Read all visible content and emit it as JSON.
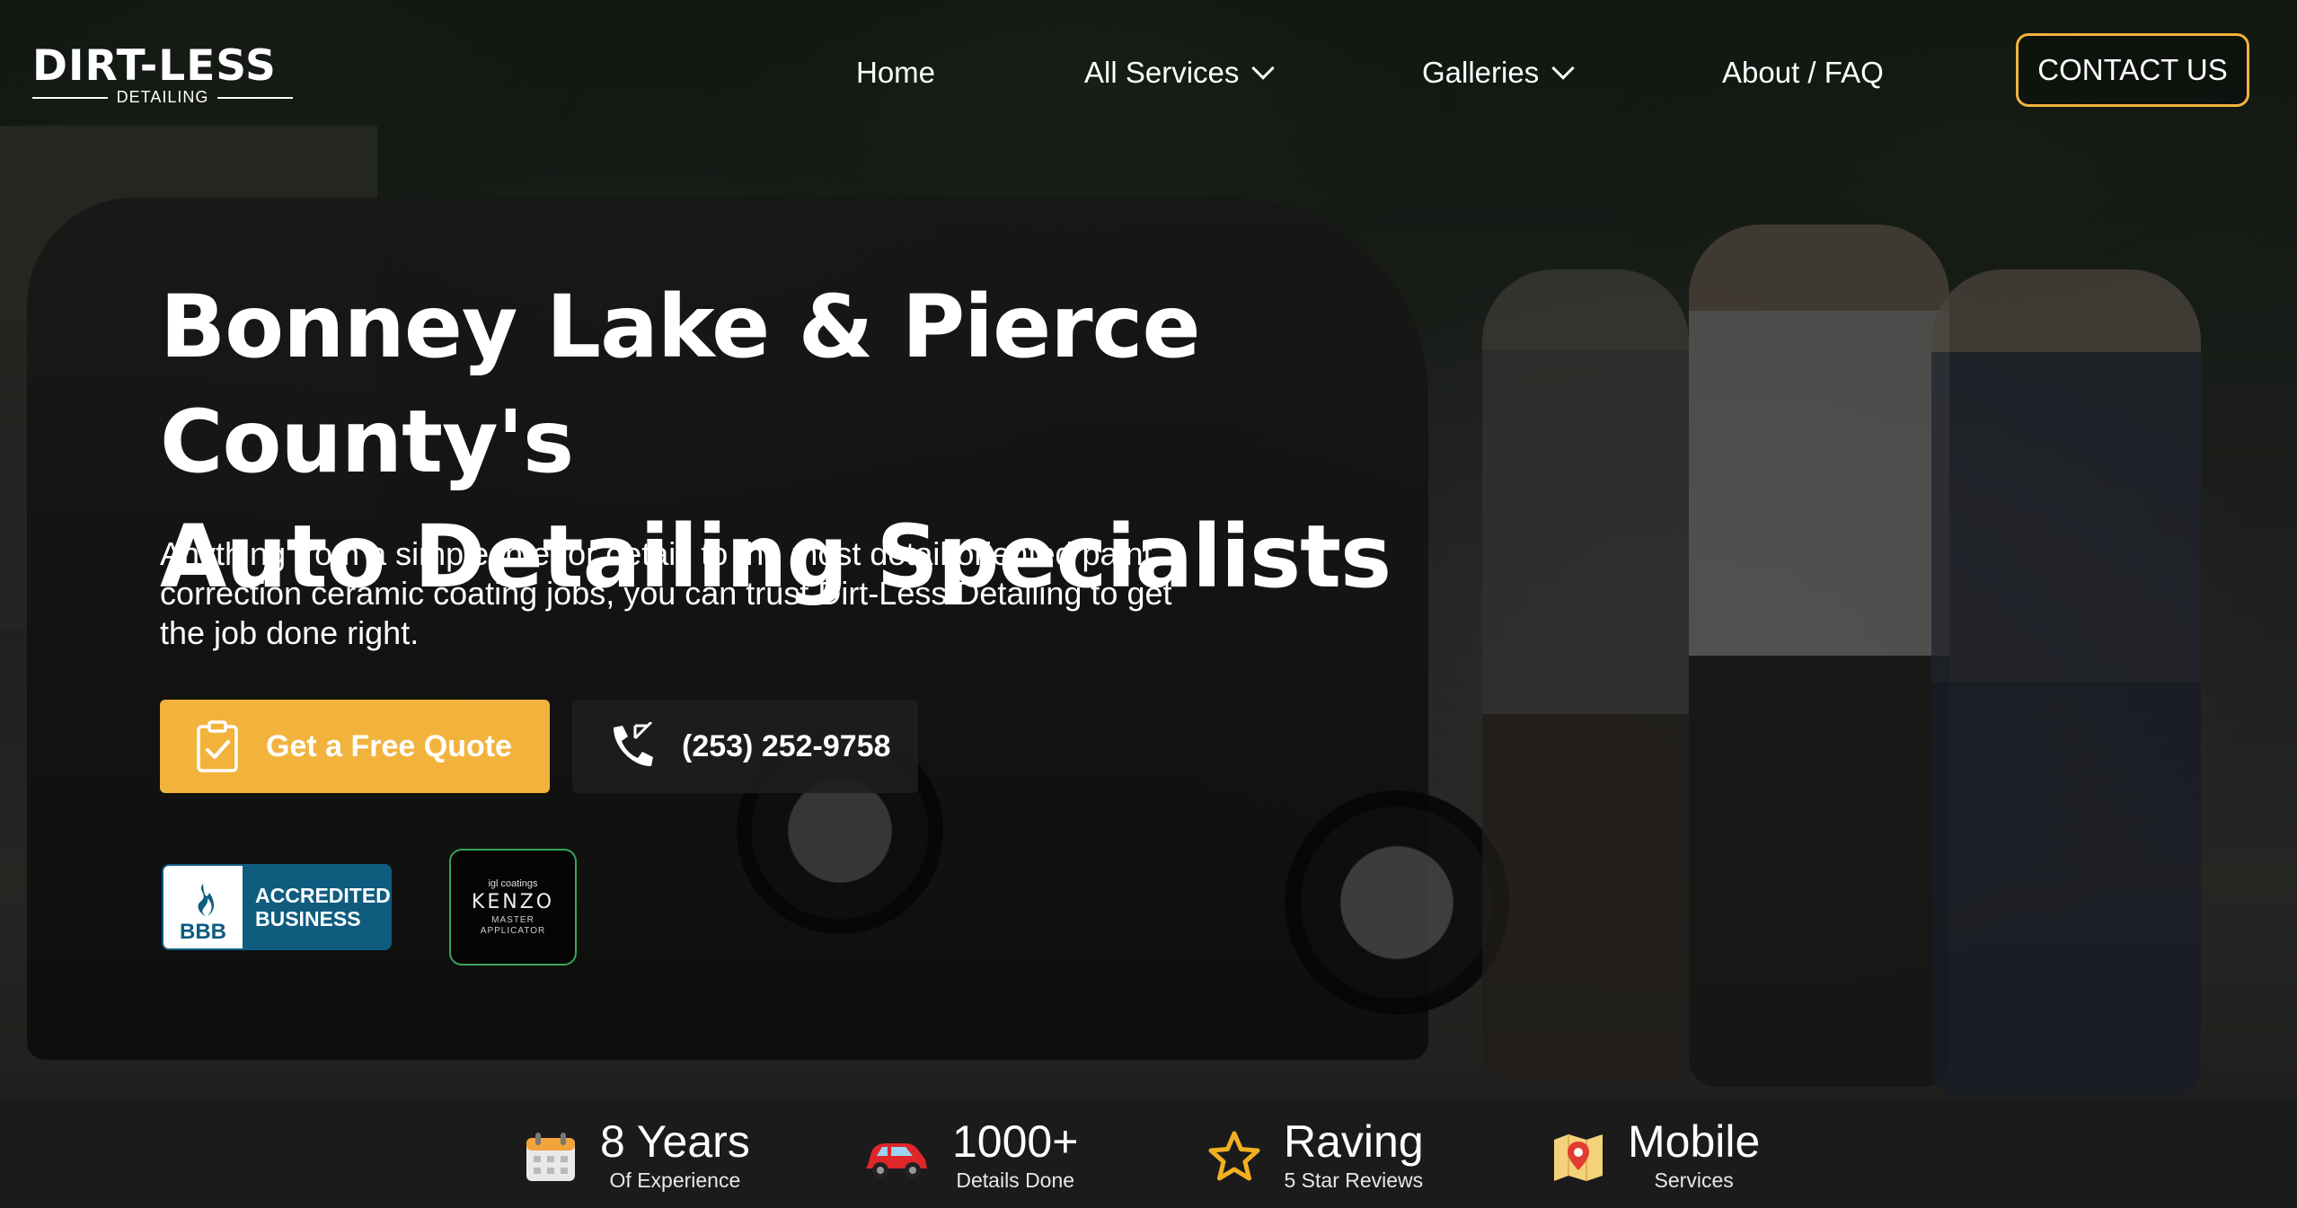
{
  "brand": {
    "logo_main": "DIRT-LESS",
    "logo_sub": "DETAILING"
  },
  "nav": {
    "home": "Home",
    "services": "All Services",
    "galleries": "Galleries",
    "about": "About / FAQ",
    "contact": "CONTACT US"
  },
  "hero": {
    "headline_line1": "Bonney Lake & Pierce County's",
    "headline_line2": "Auto Detailing Specialists",
    "subtext": "Anything from a simple interior detail, to the most detail oriented paint correction ceramic coating jobs, you can trust Dirt-Less Detailing to get the job done right.",
    "quote_button": "Get a Free Quote",
    "phone_button": "(253) 252-9758"
  },
  "badges": {
    "bbb_mark": "BBB",
    "bbb_line1": "ACCREDITED",
    "bbb_line2": "BUSINESS",
    "kenzo_top": "igl coatings",
    "kenzo_name": "KENZO",
    "kenzo_line1": "MASTER",
    "kenzo_line2": "APPLICATOR"
  },
  "stats": [
    {
      "big": "8 Years",
      "small": "Of Experience",
      "icon": "calendar-icon"
    },
    {
      "big": "1000+",
      "small": "Details Done",
      "icon": "car-icon"
    },
    {
      "big": "Raving",
      "small": "5 Star Reviews",
      "icon": "star-icon"
    },
    {
      "big": "Mobile",
      "small": "Services",
      "icon": "map-pin-icon"
    }
  ],
  "colors": {
    "accent": "#f2b33d",
    "stats_bg": "#1b1b1b",
    "bbb_blue": "#0f5c7f",
    "kenzo_green": "#39a55a"
  }
}
